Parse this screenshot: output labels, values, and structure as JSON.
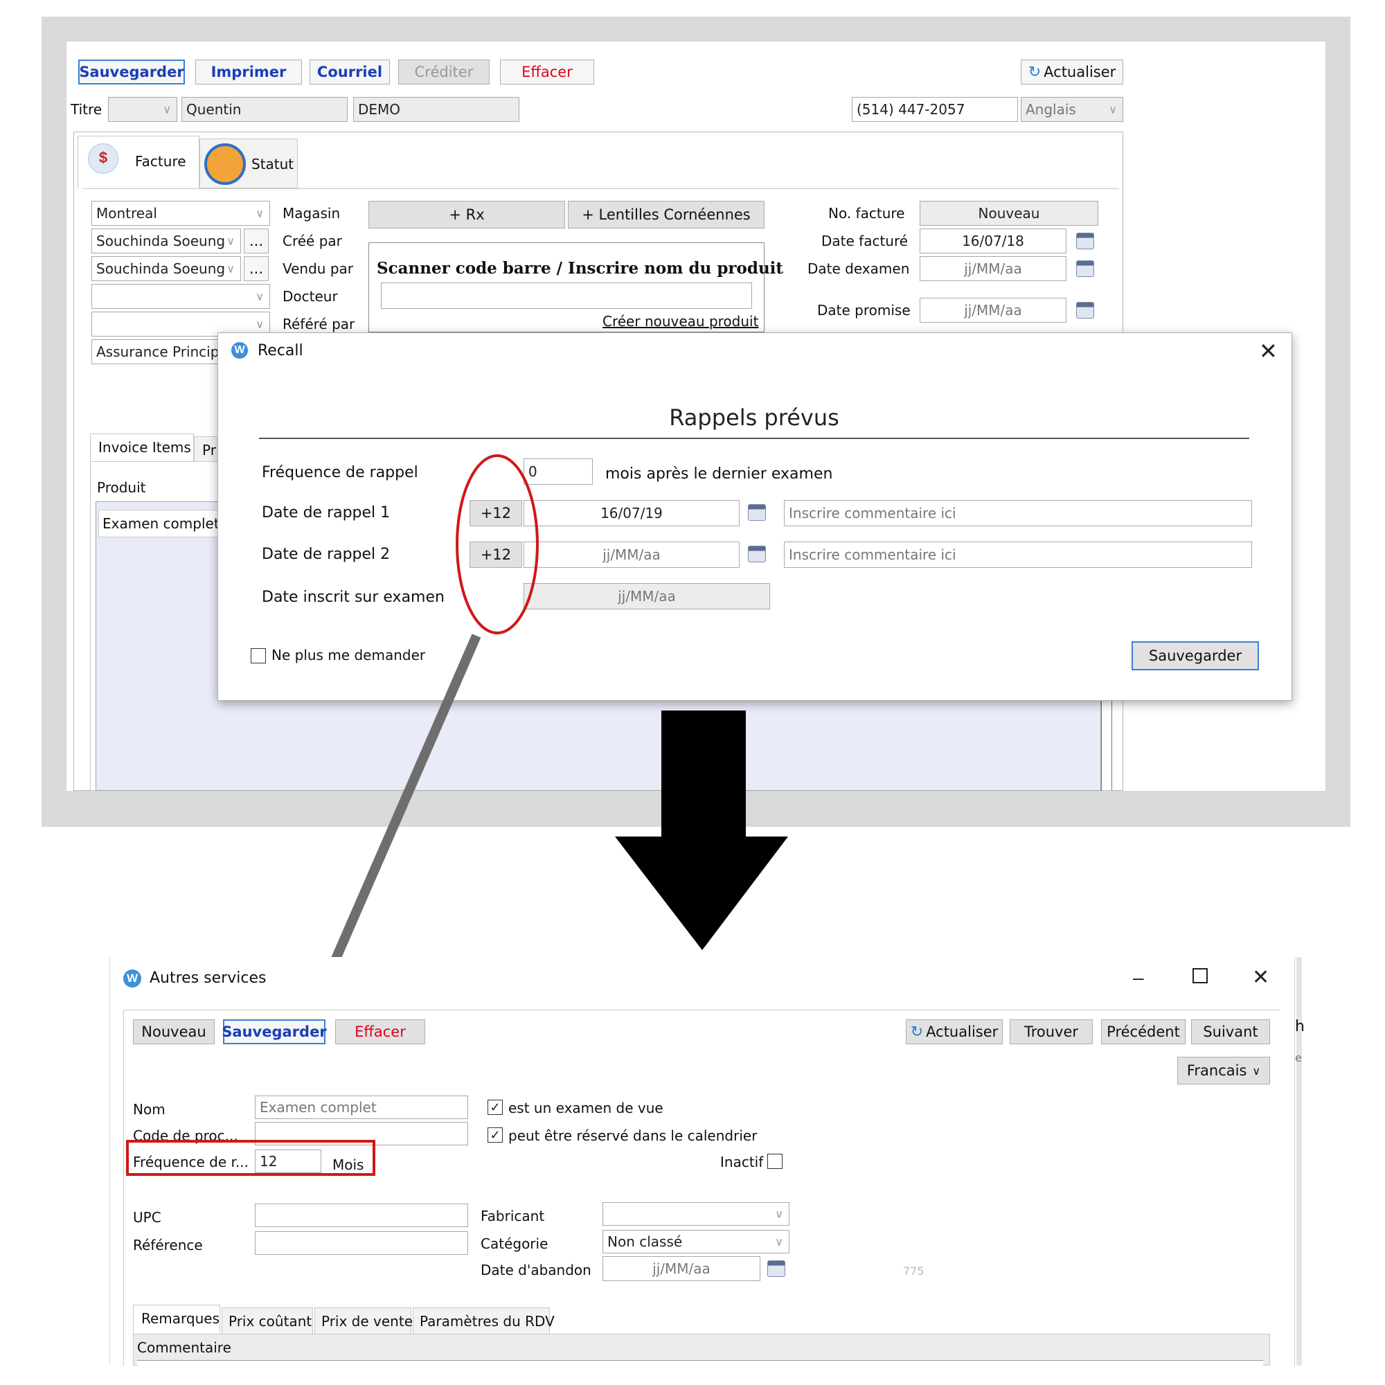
{
  "top_window": {
    "toolbar": {
      "save": "Sauvegarder",
      "print": "Imprimer",
      "email": "Courriel",
      "credit": "Créditer",
      "erase": "Effacer",
      "refresh": "Actualiser"
    },
    "customer": {
      "title_label": "Titre",
      "first_name": "Quentin",
      "last_name": "DEMO",
      "phone": "(514) 447-2057",
      "language": "Anglais"
    },
    "tabs": {
      "invoice": "Facture",
      "status": "Statut"
    },
    "left_fields": {
      "store_value": "Montreal",
      "store_label": "Magasin",
      "created_by_value": "Souchinda Soeung",
      "created_by_label": "Créé par",
      "sold_by_value": "Souchinda Soeung",
      "sold_by_label": "Vendu par",
      "doctor_label": "Docteur",
      "referred_label": "Référé par",
      "insurance_value": "Assurance Principale",
      "more": "..."
    },
    "middle": {
      "add_rx": "+ Rx",
      "add_contacts": "+ Lentilles Cornéennes",
      "scan_label": "Scanner code barre / Inscrire nom du produit",
      "new_product_link": "Créer nouveau produit"
    },
    "right_fields": {
      "invoice_no_label": "No. facture",
      "invoice_no_value": "Nouveau",
      "date_billed_label": "Date facturé",
      "date_billed_value": "16/07/18",
      "exam_date_label": "Date dexamen",
      "exam_date_value": "jj/MM/aa",
      "promised_label": "Date promise",
      "promised_value": "jj/MM/aa"
    },
    "items": {
      "tab_items": "Invoice Items",
      "tab_partial": "Pr",
      "product_header": "Produit",
      "row1": "Examen complet"
    }
  },
  "recall_dialog": {
    "title": "Recall",
    "heading": "Rappels prévus",
    "frequency_label": "Fréquence de rappel",
    "frequency_value": "0",
    "frequency_suffix": "mois après le dernier examen",
    "recall1_label": "Date de rappel 1",
    "recall1_button": "+12",
    "recall1_date": "16/07/19",
    "recall1_comment_placeholder": "Inscrire commentaire ici",
    "recall2_label": "Date de rappel 2",
    "recall2_button": "+12",
    "recall2_date": "jj/MM/aa",
    "recall2_comment_placeholder": "Inscrire commentaire ici",
    "exam_date_label": "Date inscrit sur examen",
    "exam_date_value": "jj/MM/aa",
    "dont_ask_label": "Ne plus me demander",
    "save": "Sauvegarder"
  },
  "bottom_window": {
    "title": "Autres services",
    "toolbar": {
      "new": "Nouveau",
      "save": "Sauvegarder",
      "erase": "Effacer",
      "refresh": "Actualiser",
      "find": "Trouver",
      "previous": "Précédent",
      "next": "Suivant"
    },
    "language": "Francais",
    "name_label": "Nom",
    "name_value": "Examen complet",
    "proc_code_label": "Code de proc...",
    "frequency_label": "Fréquence de r...",
    "frequency_value": "12",
    "frequency_unit": "Mois",
    "eye_exam_label": "est un examen de vue",
    "bookable_label": "peut être réservé dans le calendrier",
    "inactive_label": "Inactif",
    "upc_label": "UPC",
    "reference_label": "Référence",
    "manufacturer_label": "Fabricant",
    "category_label": "Catégorie",
    "category_value": "Non classé",
    "discontinue_label": "Date d'abandon",
    "discontinue_value": "jj/MM/aa",
    "faint_number": "775",
    "tabs": {
      "remarks": "Remarques",
      "cost": "Prix coûtant",
      "sale": "Prix de vente",
      "rdv": "Paramètres du RDV"
    },
    "comment_label": "Commentaire",
    "edge_text_1": "h",
    "edge_text_2": "e"
  },
  "colors": {
    "accent_blue": "#1a3fb8",
    "erase_red": "#e0001e",
    "highlight_red": "#d01818",
    "frame_gray": "#d9d9d9",
    "items_bg": "#e9ebf8",
    "arrow_gray": "#6e6e6e"
  }
}
